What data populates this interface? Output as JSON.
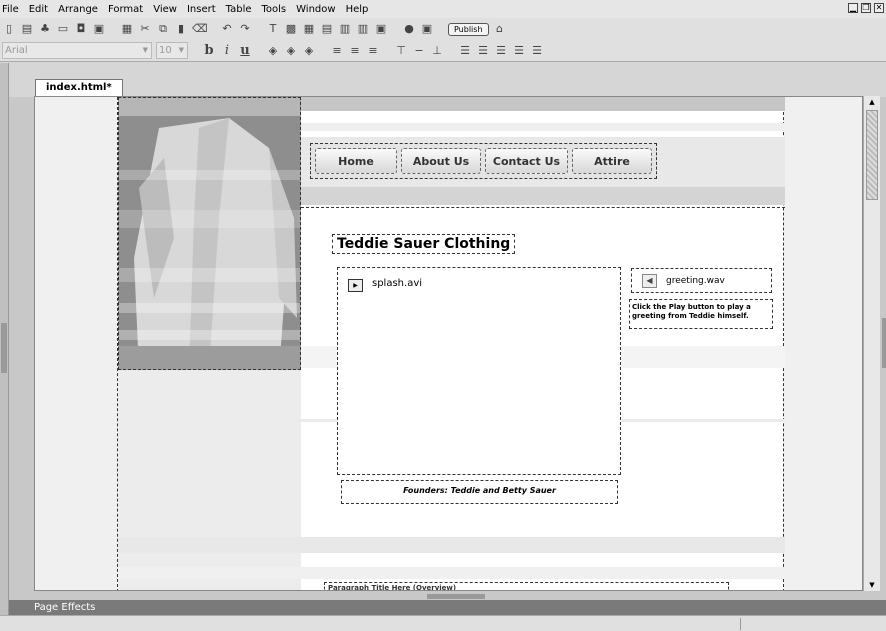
{
  "menu": [
    "File",
    "Edit",
    "Arrange",
    "Format",
    "View",
    "Insert",
    "Table",
    "Tools",
    "Window",
    "Help"
  ],
  "toolbar": {
    "publish_label": "Publish"
  },
  "format_bar": {
    "font": "Arial",
    "size": "10",
    "bold": "b",
    "italic": "i",
    "underline": "u"
  },
  "document": {
    "tab_label": "index.html*"
  },
  "page": {
    "nav": [
      "Home",
      "About Us",
      "Contact Us",
      "Attire"
    ],
    "title": "Teddie Sauer Clothing",
    "video_file": "splash.avi",
    "caption": "Founders: Teddie and Betty Sauer",
    "sound_file": "greeting.wav",
    "sound_help": "Click the Play button to play a greeting from Teddie himself.",
    "footnote": "Paragraph Title Here (Overview)"
  },
  "panels": {
    "page_effects": "Page Effects"
  }
}
